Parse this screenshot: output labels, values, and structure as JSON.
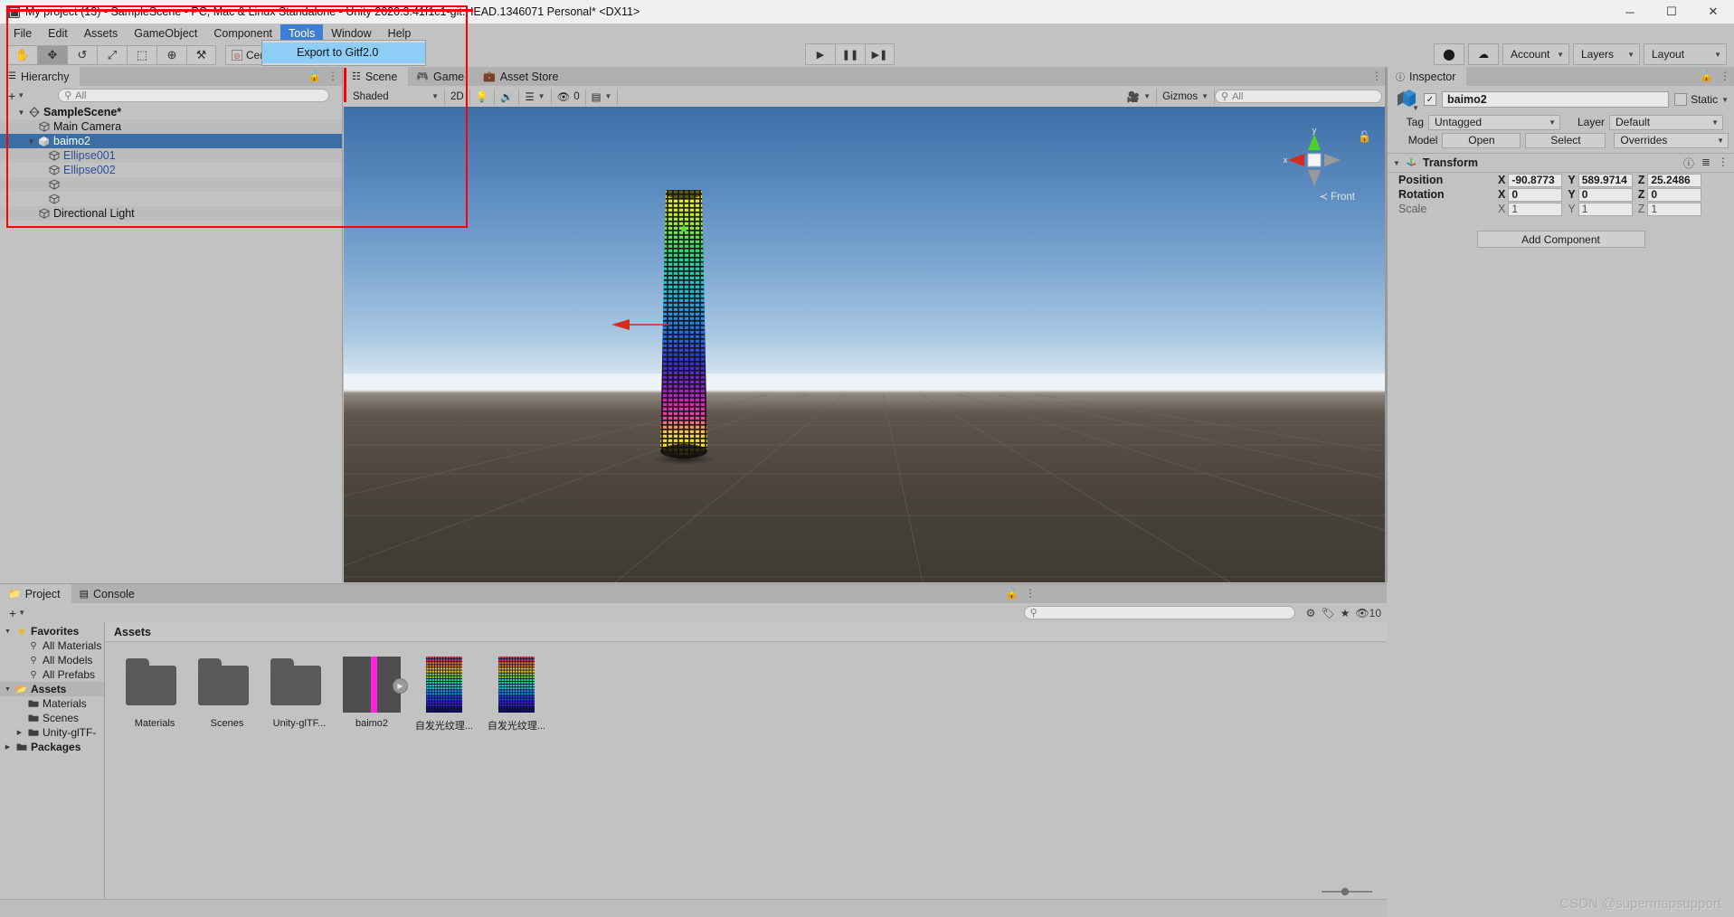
{
  "window": {
    "title": "My project (13) - SampleScene - PC, Mac & Linux Standalone - Unity 2020.3.41f1c1-git.HEAD.1346071 Personal* <DX11>",
    "minimize": "─",
    "maximize": "☐",
    "close": "✕"
  },
  "menubar": {
    "items": [
      {
        "label": "File"
      },
      {
        "label": "Edit"
      },
      {
        "label": "Assets"
      },
      {
        "label": "GameObject"
      },
      {
        "label": "Component"
      },
      {
        "label": "Tools"
      },
      {
        "label": "Window"
      },
      {
        "label": "Help"
      }
    ],
    "active_index": 5,
    "dropdown": {
      "item": "Export to Gitf2.0"
    }
  },
  "toolbar": {
    "tools": [
      "hand-tool",
      "move-tool",
      "rotate-tool",
      "scale-tool",
      "rect-tool",
      "transform-tool",
      "custom-tool"
    ],
    "tool_glyphs": [
      "✋",
      "✥",
      "↺",
      "⤢",
      "⬚",
      "⊕",
      "⚒"
    ],
    "selected_tool_index": 1,
    "pivot_label": "Cent",
    "play": "▶",
    "pause": "❚❚",
    "step": "▶❚",
    "cloud": "☁",
    "collab": "⬤",
    "account": "Account",
    "layers": "Layers",
    "layout": "Layout"
  },
  "hierarchy": {
    "tab": "Hierarchy",
    "search_placeholder": "All",
    "add_label": "+",
    "rows": [
      {
        "label": "SampleScene*",
        "indent": 1,
        "icon": "scene-icon",
        "expanded": true,
        "bold": true,
        "selected": false,
        "blue": false
      },
      {
        "label": "Main Camera",
        "indent": 2,
        "icon": "gameobject-icon",
        "expanded": null,
        "bold": false,
        "selected": false,
        "blue": false
      },
      {
        "label": "baimo2",
        "indent": 2,
        "icon": "prefab-icon",
        "expanded": true,
        "bold": false,
        "selected": true,
        "blue": false
      },
      {
        "label": "Ellipse001",
        "indent": 3,
        "icon": "gameobject-icon",
        "expanded": null,
        "bold": false,
        "selected": false,
        "blue": true
      },
      {
        "label": "Ellipse002",
        "indent": 3,
        "icon": "gameobject-icon",
        "expanded": null,
        "bold": false,
        "selected": false,
        "blue": true
      },
      {
        "label": "",
        "indent": 3,
        "icon": "gameobject-icon",
        "expanded": null,
        "bold": false,
        "selected": false,
        "blue": true
      },
      {
        "label": "",
        "indent": 3,
        "icon": "gameobject-icon",
        "expanded": null,
        "bold": false,
        "selected": false,
        "blue": true
      },
      {
        "label": "Directional Light",
        "indent": 2,
        "icon": "gameobject-icon",
        "expanded": null,
        "bold": false,
        "selected": false,
        "blue": false
      }
    ]
  },
  "scene": {
    "tabs": [
      {
        "label": "Scene",
        "icon": "grid-icon",
        "active": true
      },
      {
        "label": "Game",
        "icon": "gamepad-icon",
        "active": false
      },
      {
        "label": "Asset Store",
        "icon": "bag-icon",
        "active": false
      }
    ],
    "toolbar": {
      "draw_mode": "Shaded",
      "mode_2d": "2D",
      "lighting_icon": "lightbulb-icon",
      "audio_icon": "speaker-icon",
      "fx_icon": "effects-icon",
      "hidden_count": "0",
      "grid_icon": "grid-visibility-icon",
      "gizmos_label": "Gizmos",
      "search_placeholder": "All"
    },
    "gizmo": {
      "axis_y": "y",
      "axis_x": "x",
      "orientation_label": "Front",
      "lock_icon": "lock-icon"
    }
  },
  "inspector": {
    "tab": "Inspector",
    "object_name": "baimo2",
    "enabled": true,
    "static_label": "Static",
    "tag_label": "Tag",
    "tag_value": "Untagged",
    "layer_label": "Layer",
    "layer_value": "Default",
    "model_label": "Model",
    "open_label": "Open",
    "select_label": "Select",
    "overrides_label": "Overrides",
    "transform": {
      "title": "Transform",
      "rows": [
        {
          "name": "Position",
          "x": "-90.8773",
          "y": "589.9714",
          "z": "25.2486",
          "dim": false
        },
        {
          "name": "Rotation",
          "x": "0",
          "y": "0",
          "z": "0",
          "dim": false
        },
        {
          "name": "Scale",
          "x": "1",
          "y": "1",
          "z": "1",
          "dim": true
        }
      ],
      "axis_labels": [
        "X",
        "Y",
        "Z"
      ]
    },
    "add_component": "Add Component"
  },
  "project": {
    "tabs": [
      {
        "label": "Project",
        "icon": "folder-icon",
        "active": true
      },
      {
        "label": "Console",
        "icon": "console-icon",
        "active": false
      }
    ],
    "add_label": "+",
    "search_placeholder": "",
    "badge_count": "10",
    "tree": [
      {
        "label": "Favorites",
        "indent": 0,
        "icon": "star-icon",
        "expanded": true,
        "bold": true
      },
      {
        "label": "All Materials",
        "indent": 1,
        "icon": "search-icon",
        "expanded": null,
        "bold": false
      },
      {
        "label": "All Models",
        "indent": 1,
        "icon": "search-icon",
        "expanded": null,
        "bold": false
      },
      {
        "label": "All Prefabs",
        "indent": 1,
        "icon": "search-icon",
        "expanded": null,
        "bold": false
      },
      {
        "label": "Assets",
        "indent": 0,
        "icon": "folder-open-icon",
        "expanded": true,
        "bold": true
      },
      {
        "label": "Materials",
        "indent": 1,
        "icon": "folder-icon",
        "expanded": null,
        "bold": false
      },
      {
        "label": "Scenes",
        "indent": 1,
        "icon": "folder-icon",
        "expanded": null,
        "bold": false
      },
      {
        "label": "Unity-glTF-",
        "indent": 1,
        "icon": "folder-icon",
        "expanded": false,
        "bold": false
      },
      {
        "label": "Packages",
        "indent": 0,
        "icon": "folder-icon",
        "expanded": false,
        "bold": true
      }
    ],
    "breadcrumb": "Assets",
    "assets": [
      {
        "label": "Materials",
        "kind": "folder"
      },
      {
        "label": "Scenes",
        "kind": "folder"
      },
      {
        "label": "Unity-glTF...",
        "kind": "folder"
      },
      {
        "label": "baimo2",
        "kind": "prefab"
      },
      {
        "label": "自发光纹理...",
        "kind": "texture"
      },
      {
        "label": "自发光纹理...",
        "kind": "texture"
      }
    ]
  },
  "watermark": "CSDN @supermapsupport",
  "colors": {
    "selection_blue": "#3a6ea5",
    "menu_highlight": "#3c7fd4",
    "annotation_red": "#ff0000",
    "link_blue": "#2b4f9e",
    "panel_bg": "#c2c2c2"
  }
}
